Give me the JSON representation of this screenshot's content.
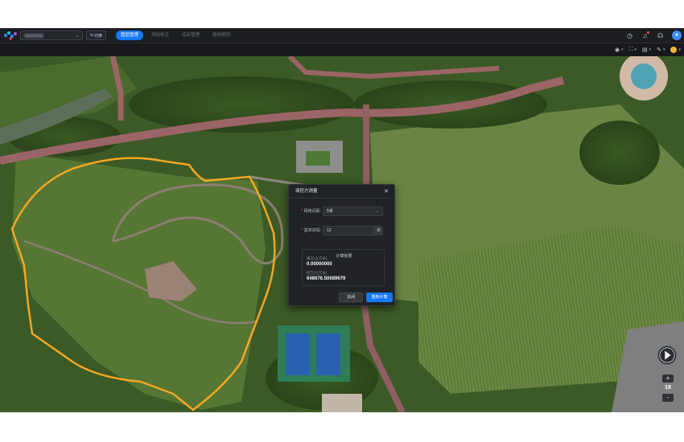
{
  "app": {
    "project_name": "",
    "switch_label": "切换",
    "tabs": [
      {
        "label": "图层管理",
        "active": true
      },
      {
        "label": "测绘标注",
        "active": false
      },
      {
        "label": "综合管理",
        "active": false
      },
      {
        "label": "路线规划",
        "active": false
      }
    ]
  },
  "toolbar": {
    "items": [
      {
        "icon": "location-pin-icon"
      },
      {
        "icon": "fullscreen-icon"
      },
      {
        "icon": "layers-icon"
      },
      {
        "icon": "measure-tool-icon"
      },
      {
        "icon": "sun-icon"
      }
    ]
  },
  "dialog": {
    "title": "填挖方测量",
    "grid_spacing_label": "网格间距:",
    "grid_spacing_value": "5米",
    "base_elevation_label": "基准高程:",
    "base_elevation_value": "12",
    "base_elevation_unit": "米",
    "result_title": "计算结果",
    "fill_label": "填方(立方米)",
    "fill_value": "0.00000000",
    "cut_label": "挖方(立方米)",
    "cut_value": "648676.50689679",
    "close_label": "关闭",
    "recalc_label": "重新计算"
  },
  "map_controls": {
    "zoom_level": "18",
    "zoom_in": "+",
    "zoom_out": "-"
  },
  "colors": {
    "accent": "#1677ff",
    "selection_outline": "#f5a623",
    "topbar_bg": "#1b1d21"
  }
}
